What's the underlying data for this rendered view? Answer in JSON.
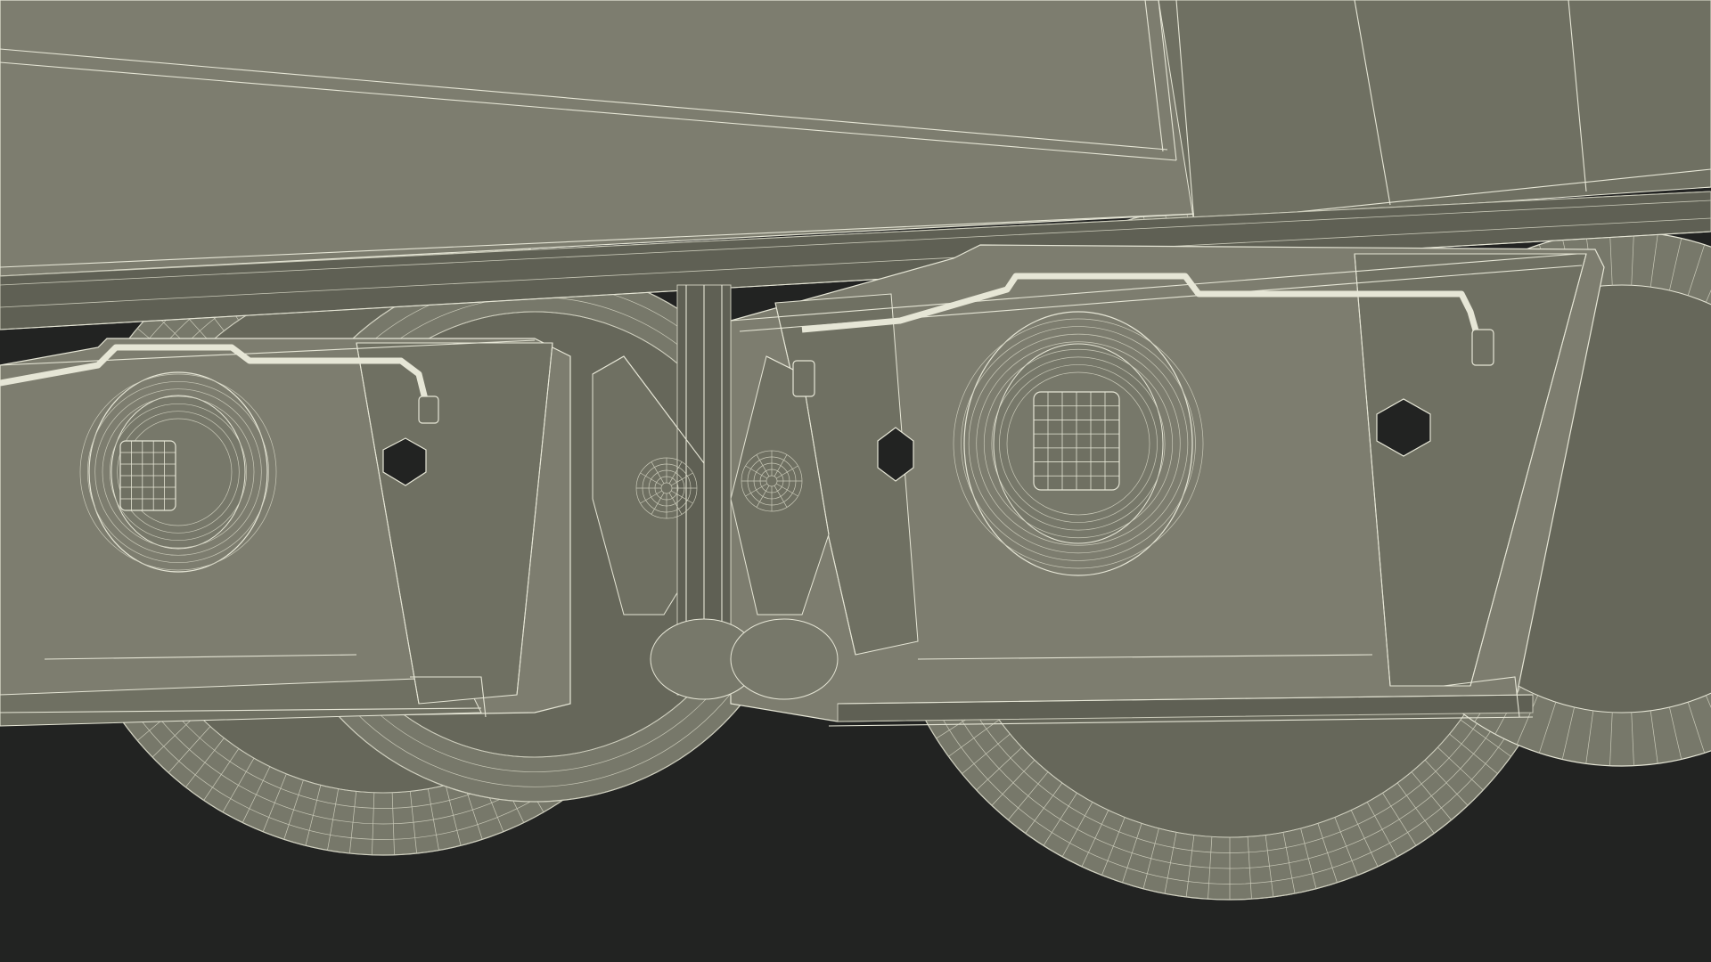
{
  "scene": {
    "subject": "wireframe-render-rail-car-bogie",
    "colors": {
      "background": "#222322",
      "body_fill": "#7d7d6f",
      "body_shade": "#6f7062",
      "under_fill": "#5f6054",
      "wheel_fill": "#77786a",
      "wheel_shade": "#66675a",
      "wire": "#e6e6d6",
      "wire_dim": "#c9c9b8"
    },
    "parts": [
      "car-body-panel",
      "lower-skirt",
      "left-wheelset",
      "right-wheelset",
      "left-axle-box",
      "right-axle-box",
      "coupler-assembly",
      "brake-pipe"
    ]
  }
}
